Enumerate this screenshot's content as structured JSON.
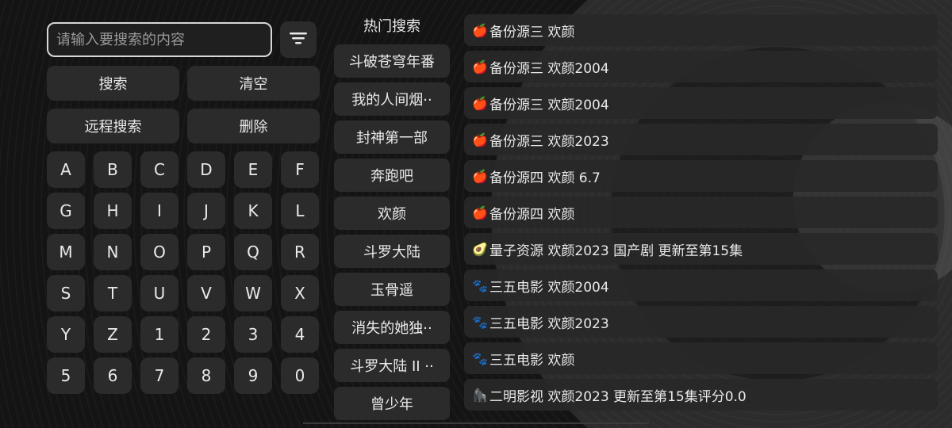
{
  "search": {
    "placeholder": "请输入要搜索的内容"
  },
  "buttons": {
    "search": "搜索",
    "clear": "清空",
    "remote_search": "远程搜索",
    "delete": "删除"
  },
  "keypad": {
    "keys": [
      "A",
      "B",
      "C",
      "D",
      "E",
      "F",
      "G",
      "H",
      "I",
      "J",
      "K",
      "L",
      "M",
      "N",
      "O",
      "P",
      "Q",
      "R",
      "S",
      "T",
      "U",
      "V",
      "W",
      "X",
      "Y",
      "Z",
      "1",
      "2",
      "3",
      "4",
      "5",
      "6",
      "7",
      "8",
      "9",
      "0"
    ]
  },
  "hot": {
    "title": "热门搜索",
    "items": [
      "斗破苍穹年番",
      "我的人间烟··",
      "封神第一部",
      "奔跑吧",
      "欢颜",
      "斗罗大陆",
      "玉骨遥",
      "消失的她独··",
      "斗罗大陆 II ··",
      "曾少年"
    ]
  },
  "results": {
    "items": [
      {
        "icon": "apple-icon",
        "text": "备份源三  欢颜"
      },
      {
        "icon": "apple-icon",
        "text": "备份源三  欢颜2004"
      },
      {
        "icon": "apple-icon",
        "text": "备份源三  欢颜2004"
      },
      {
        "icon": "apple-icon",
        "text": "备份源三  欢颜2023"
      },
      {
        "icon": "apple-icon",
        "text": "备份源四  欢颜  6.7"
      },
      {
        "icon": "apple-icon",
        "text": "备份源四  欢颜"
      },
      {
        "icon": "avocado-icon",
        "text": "量子资源  欢颜2023 国产剧 更新至第15集"
      },
      {
        "icon": "paw-icon",
        "text": "三五电影  欢颜2004"
      },
      {
        "icon": "paw-icon",
        "text": "三五电影  欢颜2023"
      },
      {
        "icon": "paw-icon",
        "text": "三五电影  欢颜"
      },
      {
        "icon": "gorilla-icon",
        "text": "二明影视  欢颜2023  更新至第15集评分0.0"
      }
    ]
  },
  "colors": {
    "background": "#141414",
    "button": "#2b2b2b",
    "border": "#d7d7d7",
    "text": "#eaeaea"
  }
}
